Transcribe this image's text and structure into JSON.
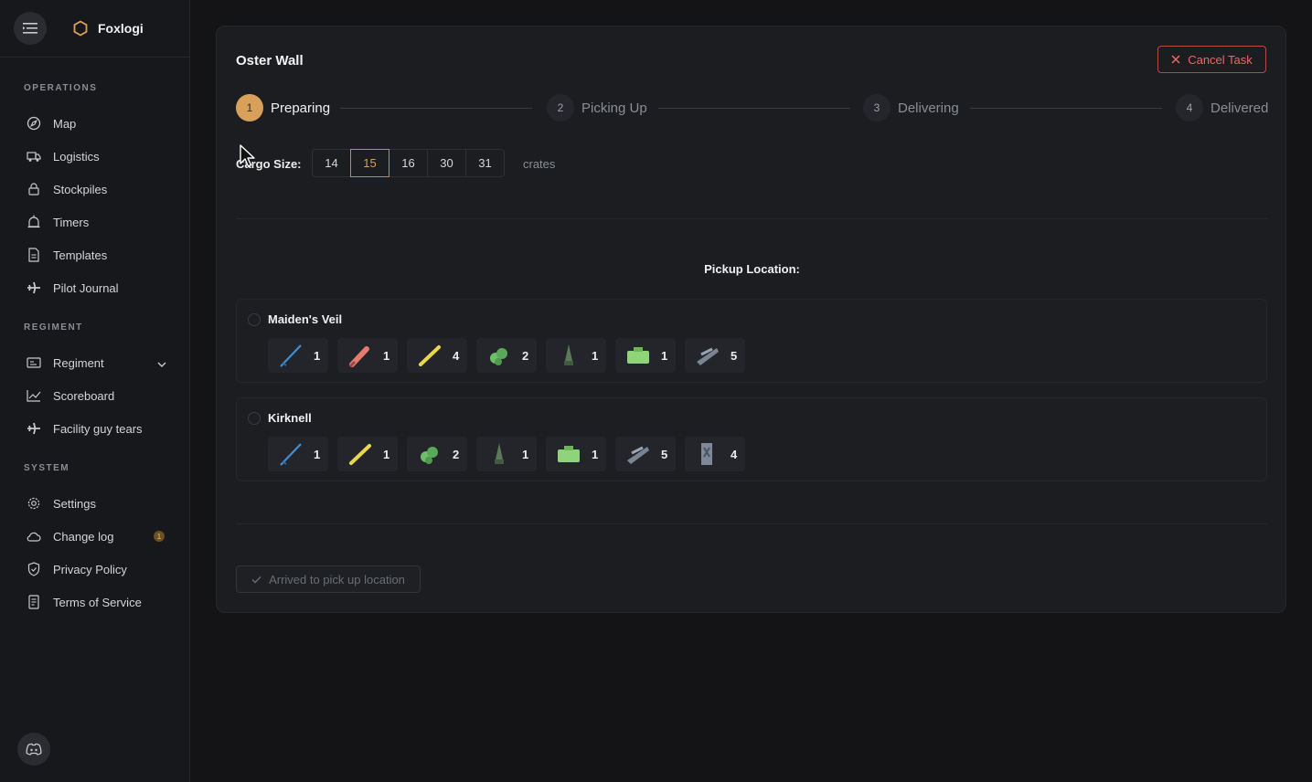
{
  "brand": {
    "name": "Foxlogi"
  },
  "sidebar": {
    "sections": [
      {
        "title": "OPERATIONS",
        "items": [
          {
            "label": "Map",
            "icon": "compass-icon"
          },
          {
            "label": "Logistics",
            "icon": "truck-icon"
          },
          {
            "label": "Stockpiles",
            "icon": "lock-icon"
          },
          {
            "label": "Timers",
            "icon": "alarm-icon"
          },
          {
            "label": "Templates",
            "icon": "document-icon"
          },
          {
            "label": "Pilot Journal",
            "icon": "plane-icon"
          }
        ]
      },
      {
        "title": "REGIMENT",
        "items": [
          {
            "label": "Regiment",
            "icon": "regiment-icon",
            "expandable": true
          },
          {
            "label": "Scoreboard",
            "icon": "chart-icon"
          },
          {
            "label": "Facility guy tears",
            "icon": "plane-icon"
          }
        ]
      },
      {
        "title": "SYSTEM",
        "items": [
          {
            "label": "Settings",
            "icon": "gear-icon"
          },
          {
            "label": "Change log",
            "icon": "cloud-icon",
            "badge": "1"
          },
          {
            "label": "Privacy Policy",
            "icon": "shield-icon"
          },
          {
            "label": "Terms of Service",
            "icon": "receipt-icon"
          }
        ]
      }
    ]
  },
  "task": {
    "title": "Oster Wall",
    "cancel_label": "Cancel Task",
    "steps": [
      {
        "num": "1",
        "label": "Preparing",
        "active": true
      },
      {
        "num": "2",
        "label": "Picking Up",
        "active": false
      },
      {
        "num": "3",
        "label": "Delivering",
        "active": false
      },
      {
        "num": "4",
        "label": "Delivered",
        "active": false
      }
    ],
    "cargo": {
      "label": "Cargo Size:",
      "options": [
        "14",
        "15",
        "16",
        "30",
        "31"
      ],
      "selected": "15",
      "unit": "crates"
    },
    "pickup_heading": "Pickup Location:",
    "locations": [
      {
        "name": "Maiden's Veil",
        "items": [
          {
            "icon": "rifle-icon",
            "qty": "1"
          },
          {
            "icon": "rocket-icon",
            "qty": "1"
          },
          {
            "icon": "stick-grenade-icon",
            "qty": "4"
          },
          {
            "icon": "grenade-cluster-icon",
            "qty": "2"
          },
          {
            "icon": "mortar-shell-icon",
            "qty": "1"
          },
          {
            "icon": "ammo-crate-icon",
            "qty": "1"
          },
          {
            "icon": "launcher-icon",
            "qty": "5"
          }
        ]
      },
      {
        "name": "Kirknell",
        "items": [
          {
            "icon": "rifle-icon",
            "qty": "1"
          },
          {
            "icon": "stick-grenade-icon",
            "qty": "1"
          },
          {
            "icon": "grenade-cluster-icon",
            "qty": "2"
          },
          {
            "icon": "mortar-shell-icon",
            "qty": "1"
          },
          {
            "icon": "ammo-crate-icon",
            "qty": "1"
          },
          {
            "icon": "launcher-icon",
            "qty": "5"
          },
          {
            "icon": "supply-box-icon",
            "qty": "4"
          }
        ]
      }
    ],
    "arrived_label": "Arrived to pick up location"
  },
  "colors": {
    "accent": "#d9a05c",
    "danger": "#e86a63",
    "background": "#141417",
    "card": "#1b1d21"
  }
}
